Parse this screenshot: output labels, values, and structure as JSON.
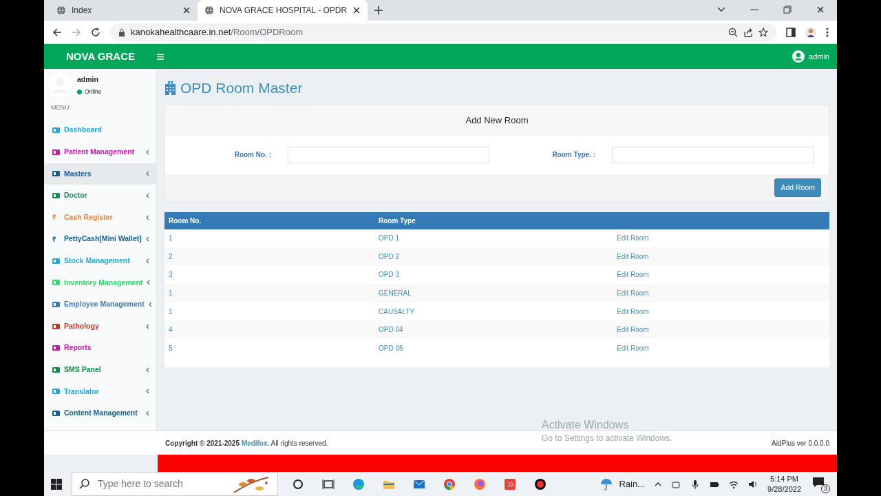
{
  "browser": {
    "tabs": [
      {
        "title": "Index",
        "selected": false
      },
      {
        "title": "NOVA GRACE HOSPITAL - OPDR",
        "selected": true
      }
    ],
    "url_host": "kanokahealthcaare.in.net",
    "url_path": "/Room/OPDRoom"
  },
  "navbar": {
    "brand": "NOVA GRACE",
    "user": "admin"
  },
  "sidebar": {
    "user": "admin",
    "status": "Online",
    "menu_label": "MENU",
    "items": [
      {
        "label": "Dashboard",
        "color": "#1fa8d8",
        "expandable": false,
        "hovered": false
      },
      {
        "label": "Patient Management",
        "color": "#c21fa8",
        "expandable": true,
        "hovered": false
      },
      {
        "label": "Masters",
        "color": "#1d5a8a",
        "expandable": true,
        "hovered": true
      },
      {
        "label": "Doctor",
        "color": "#1d8a4e",
        "expandable": true,
        "hovered": false
      },
      {
        "label": "Cash Register",
        "color": "#e8833a",
        "expandable": true,
        "hovered": false,
        "glyph": "₹"
      },
      {
        "label": "PettyCash[Mini Wallet]",
        "color": "#135e8c",
        "expandable": true,
        "hovered": false,
        "glyph": "₹"
      },
      {
        "label": "Stock Management",
        "color": "#23a7d6",
        "expandable": true,
        "hovered": false
      },
      {
        "label": "Inventory Management",
        "color": "#2fd96a",
        "expandable": true,
        "hovered": false
      },
      {
        "label": "Employee Management",
        "color": "#3f79b0",
        "expandable": true,
        "hovered": false
      },
      {
        "label": "Pathology",
        "color": "#c0392b",
        "expandable": true,
        "hovered": false
      },
      {
        "label": "Reports",
        "color": "#c21fa8",
        "expandable": false,
        "hovered": false
      },
      {
        "label": "SMS Panel",
        "color": "#16894a",
        "expandable": true,
        "hovered": false
      },
      {
        "label": "Translator",
        "color": "#23a7d6",
        "expandable": true,
        "hovered": false
      },
      {
        "label": "Content Management",
        "color": "#135e8c",
        "expandable": true,
        "hovered": false
      }
    ]
  },
  "page": {
    "title": "OPD Room Master",
    "form_title": "Add New Room",
    "fields": [
      {
        "label": "Room No. :"
      },
      {
        "label": "Room Type. :"
      }
    ],
    "submit": "Add Room"
  },
  "table": {
    "columns": [
      "Room No.",
      "Room Type"
    ],
    "rows": [
      {
        "room_no": "1",
        "room_type": "OPD 1",
        "action": "Edit Room"
      },
      {
        "room_no": "2",
        "room_type": "OPD 2",
        "action": "Edit Room"
      },
      {
        "room_no": "3",
        "room_type": "OPD 3",
        "action": "Edit Room"
      },
      {
        "room_no": "1",
        "room_type": "GENERAL",
        "action": "Edit Room"
      },
      {
        "room_no": "1",
        "room_type": "CAUSALTY",
        "action": "Edit Room"
      },
      {
        "room_no": "4",
        "room_type": "OPD 04",
        "action": "Edit Room"
      },
      {
        "room_no": "5",
        "room_type": "OPD 05",
        "action": "Edit Room"
      }
    ]
  },
  "footer": {
    "copyright": "Copyright © 2021-2025 ",
    "brand": "Medifox",
    "rest": ". All rights reserved.",
    "version": "AidPlus ver 0.0.0.0"
  },
  "os_notice": {
    "title": "Activate Windows",
    "text": "Go to Settings to activate Windows."
  },
  "taskbar": {
    "search_placeholder": "Type here to search",
    "weather": "Rain...",
    "time": "5:14 PM",
    "date": "9/28/2022",
    "notifications": "3"
  }
}
